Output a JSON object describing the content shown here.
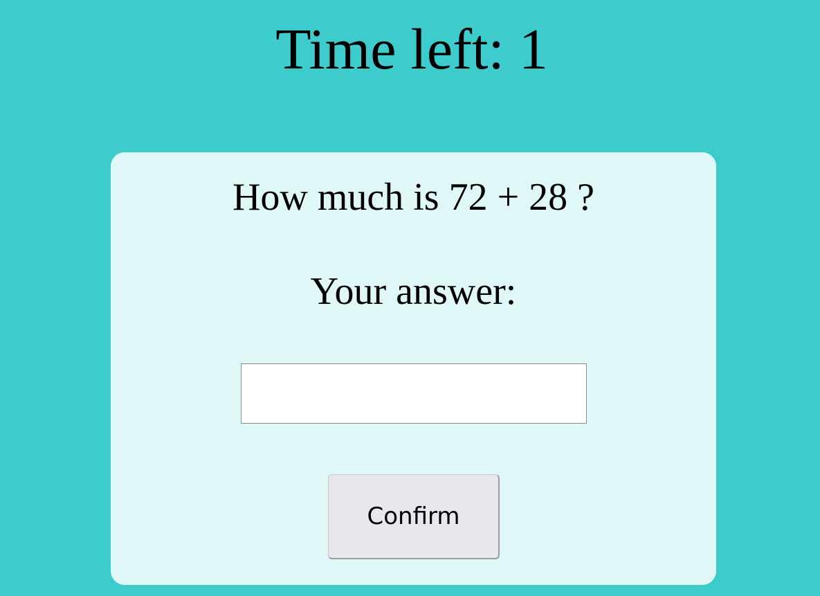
{
  "header": {
    "timer_text": "Time left: 1"
  },
  "quiz": {
    "question": "How much is 72 + 28 ?",
    "answer_label": "Your answer:",
    "answer_value": "",
    "answer_placeholder": "",
    "confirm_label": "Confirm"
  },
  "colors": {
    "background": "#3dcbcc",
    "card": "#dff7f7",
    "button": "#e8e7ec",
    "input": "#ffffff"
  }
}
